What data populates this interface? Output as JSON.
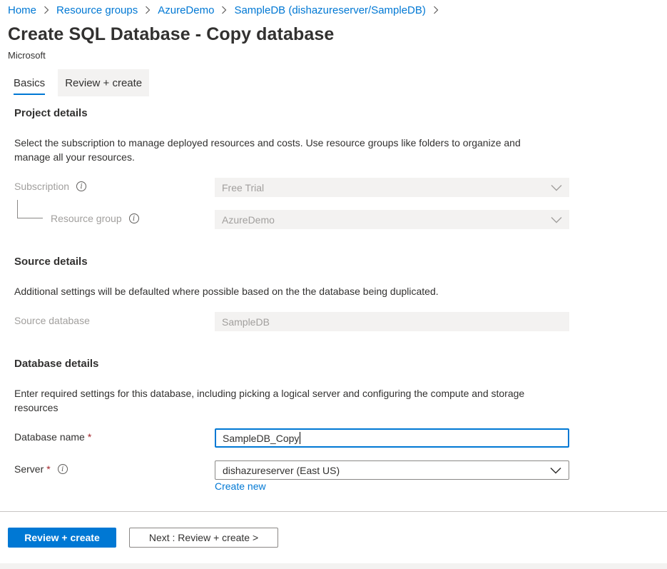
{
  "breadcrumb": [
    {
      "label": "Home"
    },
    {
      "label": "Resource groups"
    },
    {
      "label": "AzureDemo"
    },
    {
      "label": "SampleDB (dishazureserver/SampleDB)"
    }
  ],
  "header": {
    "title": "Create SQL Database - Copy database",
    "publisher": "Microsoft"
  },
  "tabs": [
    {
      "label": "Basics",
      "active": true
    },
    {
      "label": "Review + create",
      "active": false
    }
  ],
  "project": {
    "title": "Project details",
    "description": "Select the subscription to manage deployed resources and costs. Use resource groups like folders to organize and manage all your resources.",
    "subscription_label": "Subscription",
    "subscription_value": "Free Trial",
    "resource_group_label": "Resource group",
    "resource_group_value": "AzureDemo"
  },
  "source": {
    "title": "Source details",
    "description": "Additional settings will be defaulted where possible based on the the database being duplicated.",
    "source_db_label": "Source database",
    "source_db_value": "SampleDB"
  },
  "database": {
    "title": "Database details",
    "description": "Enter required settings for this database, including picking a logical server and configuring the compute and storage resources",
    "name_label": "Database name",
    "name_value": "SampleDB_Copy",
    "server_label": "Server",
    "server_value": "dishazureserver (East US)",
    "create_new": "Create new",
    "required_marker": "*"
  },
  "footer": {
    "primary_label": "Review + create",
    "secondary_label": "Next : Review + create >"
  },
  "icons": {
    "breadcrumb_separator": "chevron-right-icon",
    "info": "info-icon",
    "dropdown": "chevron-down-icon"
  },
  "colors": {
    "accent": "#0078d4",
    "required": "#a4262c",
    "disabled_bg": "#f3f2f1",
    "disabled_text": "#a19f9d"
  }
}
